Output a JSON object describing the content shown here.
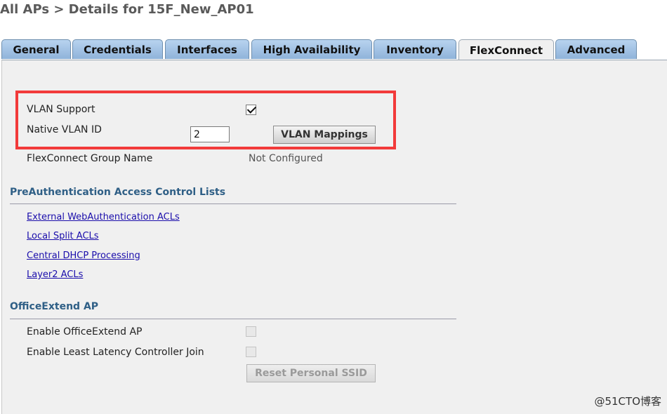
{
  "page": {
    "title": "All APs > Details for 15F_New_AP01"
  },
  "tabs": [
    {
      "label": "General",
      "active": false
    },
    {
      "label": "Credentials",
      "active": false
    },
    {
      "label": "Interfaces",
      "active": false
    },
    {
      "label": "High Availability",
      "active": false
    },
    {
      "label": "Inventory",
      "active": false
    },
    {
      "label": "FlexConnect",
      "active": true
    },
    {
      "label": "Advanced",
      "active": false
    }
  ],
  "flexconnect": {
    "vlan_support_label": "VLAN Support",
    "vlan_support_checked": true,
    "native_vlan_label": "Native VLAN ID",
    "native_vlan_value": "2",
    "vlan_mappings_button": "VLAN Mappings",
    "group_name_label": "FlexConnect Group Name",
    "group_name_value": "Not Configured"
  },
  "preauth": {
    "title": "PreAuthentication Access Control Lists",
    "links": [
      "External WebAuthentication ACLs",
      "Local Split ACLs",
      "Central DHCP Processing",
      "Layer2 ACLs"
    ]
  },
  "officeextend": {
    "title": "OfficeExtend AP",
    "enable_label": "Enable OfficeExtend AP",
    "enable_checked": false,
    "least_latency_label": "Enable Least Latency Controller Join",
    "least_latency_checked": false,
    "reset_button": "Reset Personal SSID"
  },
  "watermark": "@51CTO博客",
  "colors": {
    "highlight": "#f23a3a",
    "section_title": "#2f5f86",
    "link": "#1a0dab",
    "tab_inactive": "#a6c5e6",
    "panel": "#f0f0f0"
  }
}
